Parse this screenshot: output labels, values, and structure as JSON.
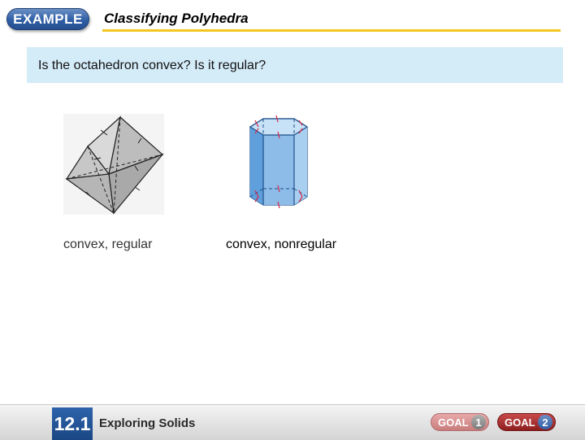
{
  "header": {
    "badge_label": "EXAMPLE",
    "lesson_title": "Classifying Polyhedra"
  },
  "question": "Is the octahedron convex? Is it regular?",
  "figures": [
    {
      "icon": "octahedron-icon",
      "caption": "convex, regular"
    },
    {
      "icon": "hexagonal-prism-icon",
      "caption": "convex, nonregular"
    }
  ],
  "footer": {
    "lesson_number": "12.1",
    "lesson_name": "Exploring Solids",
    "goals": [
      {
        "label": "GOAL",
        "number": "1"
      },
      {
        "label": "GOAL",
        "number": "2"
      }
    ]
  },
  "colors": {
    "accent_rule": "#f2c61f",
    "question_bg": "#d4ebf8",
    "badge_blue": "#2f5ea6",
    "goal_red": "#8e1f1f"
  }
}
